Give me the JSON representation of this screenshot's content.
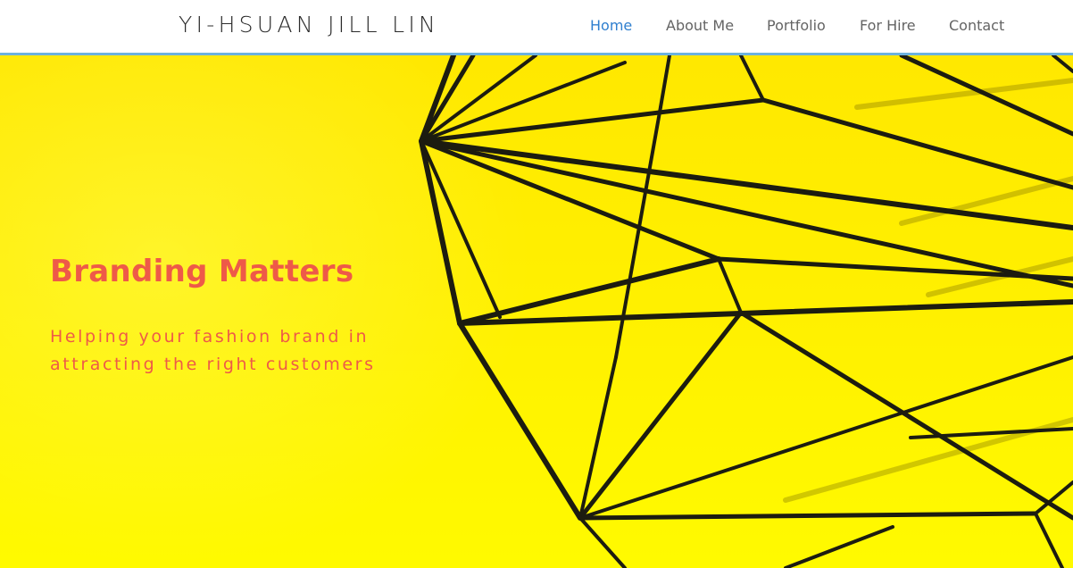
{
  "site": {
    "title": "YI-HSUAN JILL LIN"
  },
  "nav": {
    "items": [
      {
        "label": "Home",
        "active": true
      },
      {
        "label": "About Me",
        "active": false
      },
      {
        "label": "Portfolio",
        "active": false
      },
      {
        "label": "For Hire",
        "active": false
      },
      {
        "label": "Contact",
        "active": false
      }
    ]
  },
  "hero": {
    "heading": "Branding Matters",
    "subheading": "Helping your fashion brand in attracting the right customers",
    "background_color": "#fff200",
    "accent_text_color": "#ee5a48"
  },
  "colors": {
    "nav_active": "#2f7fcf",
    "nav_default": "#646464",
    "header_border": "#6cb2de"
  }
}
